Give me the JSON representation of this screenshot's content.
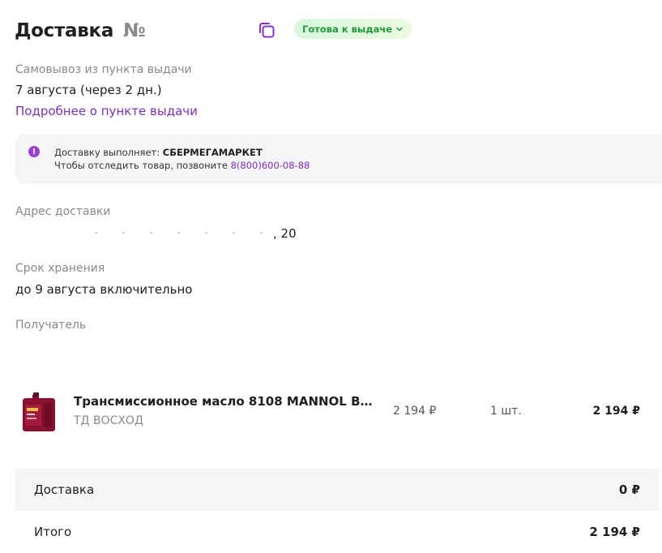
{
  "header": {
    "title": "Доставка",
    "order_prefix": "№",
    "copy_icon": "copy-icon",
    "status": "Готова к выдаче",
    "status_color": "#1f9a3a"
  },
  "pickup": {
    "method": "Самовывоз из пункта выдачи",
    "date": "7 августа (через 2 дн.)",
    "details_link": "Подробнее о пункте выдачи"
  },
  "info": {
    "icon": "alert-icon",
    "carrier_prefix": "Доставку выполняет:",
    "carrier": "СБЕРМЕГАМАРКЕТ",
    "track_text": "Чтобы отследить товар, позвоните",
    "phone": "8(800)600-08-88"
  },
  "address": {
    "label": "Адрес доставки",
    "value_tail": ", 20"
  },
  "storage": {
    "label": "Срок хранения",
    "value": "до 9 августа включительно"
  },
  "recipient": {
    "label": "Получатель"
  },
  "product": {
    "name": "Трансмиссионное масло 8108 MANNOL BA...",
    "seller": "ТД ВОСХОД",
    "price": "2 194 ₽",
    "qty": "1 шт.",
    "total": "2 194 ₽"
  },
  "summary": {
    "delivery_label": "Доставка",
    "delivery_value": "0 ₽",
    "total_label": "Итого",
    "total_value": "2 194 ₽"
  },
  "colors": {
    "accent": "#7b2fbe",
    "status_bg": "#d8f7dc"
  }
}
